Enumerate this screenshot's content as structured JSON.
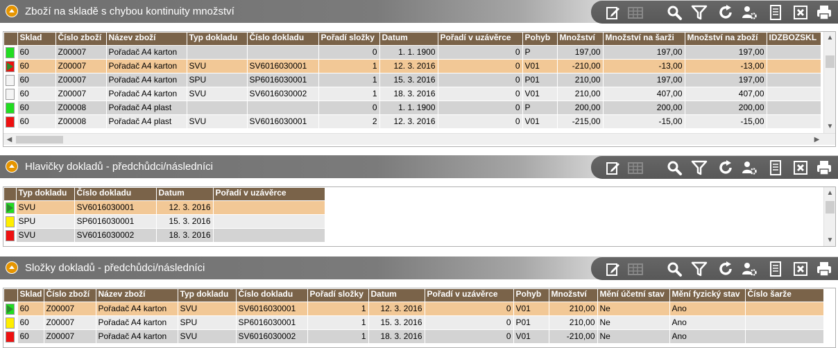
{
  "toolbar": {
    "icons": [
      "edit-icon",
      "table-disabled-icon",
      "search-icon",
      "filter-icon",
      "refresh-icon",
      "user-settings-icon",
      "document-icon",
      "excel-icon",
      "print-icon"
    ]
  },
  "panel1": {
    "title": "Zboží na skladě s chybou kontinuity množství",
    "columns": [
      "Sklad",
      "Číslo zboží",
      "Název zboží",
      "Typ dokladu",
      "Číslo dokladu",
      "Pořadí složky",
      "Datum",
      "Pořadí v uzávěrce",
      "Pohyb",
      "Množství",
      "Množství na šarži",
      "Množství na zboží",
      "IDZBOZSKL"
    ],
    "rows": [
      {
        "status": "green",
        "cells": [
          "60",
          "Z00007",
          "Pořadač A4 karton",
          "",
          "",
          "0",
          "1. 1. 1900",
          "0",
          "P",
          "197,00",
          "197,00",
          "197,00",
          ""
        ]
      },
      {
        "status": "arrow",
        "cells": [
          "60",
          "Z00007",
          "Pořadač A4 karton",
          "SVU",
          "SV6016030001",
          "1",
          "12. 3. 2016",
          "0",
          "V01",
          "-210,00",
          "-13,00",
          "-13,00",
          ""
        ]
      },
      {
        "status": "white",
        "cells": [
          "60",
          "Z00007",
          "Pořadač A4 karton",
          "SPU",
          "SP6016030001",
          "1",
          "15. 3. 2016",
          "0",
          "P01",
          "210,00",
          "197,00",
          "197,00",
          ""
        ]
      },
      {
        "status": "white",
        "cells": [
          "60",
          "Z00007",
          "Pořadač A4 karton",
          "SVU",
          "SV6016030002",
          "1",
          "18. 3. 2016",
          "0",
          "V01",
          "210,00",
          "407,00",
          "407,00",
          ""
        ]
      },
      {
        "status": "green",
        "cells": [
          "60",
          "Z00008",
          "Pořadač A4 plast",
          "",
          "",
          "0",
          "1. 1. 1900",
          "0",
          "P",
          "200,00",
          "200,00",
          "200,00",
          ""
        ]
      },
      {
        "status": "red",
        "cells": [
          "60",
          "Z00008",
          "Pořadač A4 plast",
          "SVU",
          "SV6016030001",
          "2",
          "12. 3. 2016",
          "0",
          "V01",
          "-215,00",
          "-15,00",
          "-15,00",
          ""
        ]
      }
    ]
  },
  "panel2": {
    "title": "Hlavičky dokladů - předchůdci/následníci",
    "columns": [
      "Typ dokladu",
      "Číslo dokladu",
      "Datum",
      "Pořadí v uzávěrce"
    ],
    "rows": [
      {
        "status": "arrowg",
        "cells": [
          "SVU",
          "SV6016030001",
          "12. 3. 2016",
          ""
        ]
      },
      {
        "status": "yellow",
        "cells": [
          "SPU",
          "SP6016030001",
          "15. 3. 2016",
          ""
        ]
      },
      {
        "status": "red",
        "cells": [
          "SVU",
          "SV6016030002",
          "18. 3. 2016",
          ""
        ]
      }
    ]
  },
  "panel3": {
    "title": "Složky dokladů - předchůdci/následníci",
    "columns": [
      "Sklad",
      "Číslo zboží",
      "Název zboží",
      "Typ dokladu",
      "Číslo dokladu",
      "Pořadí složky",
      "Datum",
      "Pořadí v uzávěrce",
      "Pohyb",
      "Množství",
      "Mění účetní stav",
      "Mění fyzický stav",
      "Číslo šarže"
    ],
    "rows": [
      {
        "status": "arrowg",
        "cells": [
          "60",
          "Z00007",
          "Pořadač A4 karton",
          "SVU",
          "SV6016030001",
          "1",
          "12. 3. 2016",
          "0",
          "V01",
          "210,00",
          "Ne",
          "Ano",
          ""
        ]
      },
      {
        "status": "yellow",
        "cells": [
          "60",
          "Z00007",
          "Pořadač A4 karton",
          "SPU",
          "SP6016030001",
          "1",
          "15. 3. 2016",
          "0",
          "P01",
          "210,00",
          "Ne",
          "Ano",
          ""
        ]
      },
      {
        "status": "red",
        "cells": [
          "60",
          "Z00007",
          "Pořadač A4 karton",
          "SVU",
          "SV6016030002",
          "1",
          "18. 3. 2016",
          "0",
          "V01",
          "-210,00",
          "Ne",
          "Ano",
          ""
        ]
      }
    ]
  }
}
